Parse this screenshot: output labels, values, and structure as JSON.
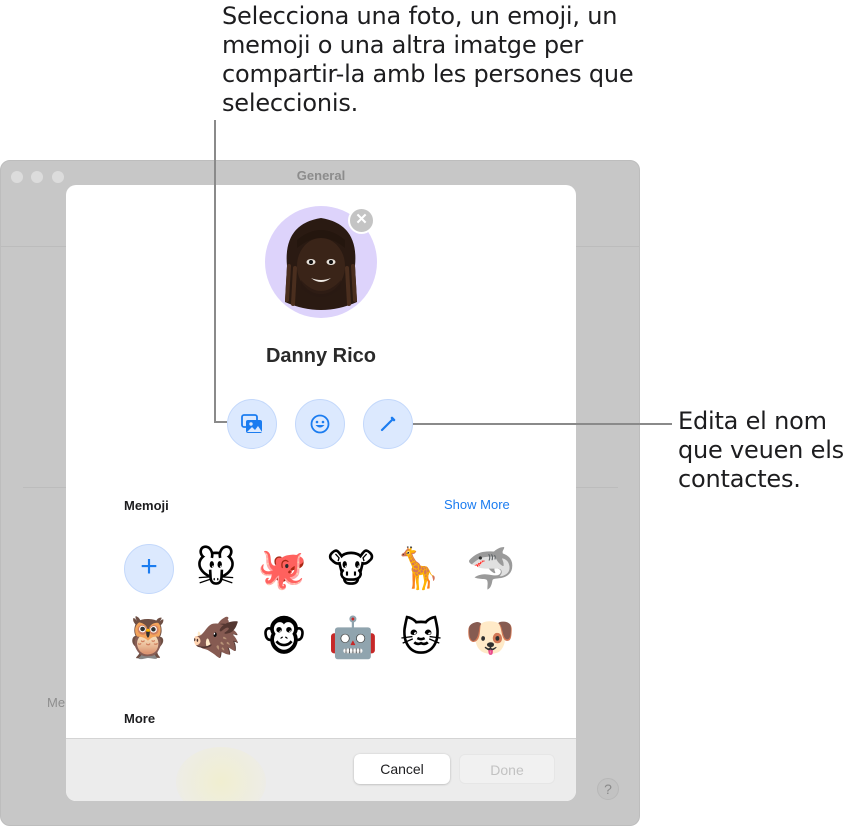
{
  "callouts": {
    "top": "Selecciona una foto, un emoji, un memoji o una altra imatge per compartir-la amb les persones que seleccionis.",
    "right": "Edita el nom que veuen els contactes."
  },
  "window": {
    "title": "General",
    "partial_label": "Me",
    "help_label": "?"
  },
  "sheet": {
    "remove_label": "✕",
    "name": "Danny Rico",
    "actions": [
      {
        "name": "photos",
        "label": "Photos"
      },
      {
        "name": "emoji",
        "label": "Emoji"
      },
      {
        "name": "edit-name",
        "label": "Edit name"
      }
    ],
    "memoji_section": {
      "title": "Memoji",
      "show_more": "Show More",
      "add_label": "+",
      "items": [
        "🐭",
        "🐙",
        "🐮",
        "🦒",
        "🦈",
        "🦉",
        "🐗",
        "🐵",
        "🤖",
        "🐱",
        "🐶"
      ],
      "item_names": [
        "mouse",
        "octopus",
        "cow",
        "giraffe",
        "shark",
        "owl",
        "boar",
        "monkey",
        "robot",
        "cat",
        "dog"
      ]
    },
    "more_section": {
      "title": "More"
    },
    "footer": {
      "cancel": "Cancel",
      "done": "Done"
    }
  },
  "colors": {
    "accent": "#1b7cf0",
    "avatar_bg": "#ddd3fb",
    "action_bg": "#dce9fe"
  }
}
